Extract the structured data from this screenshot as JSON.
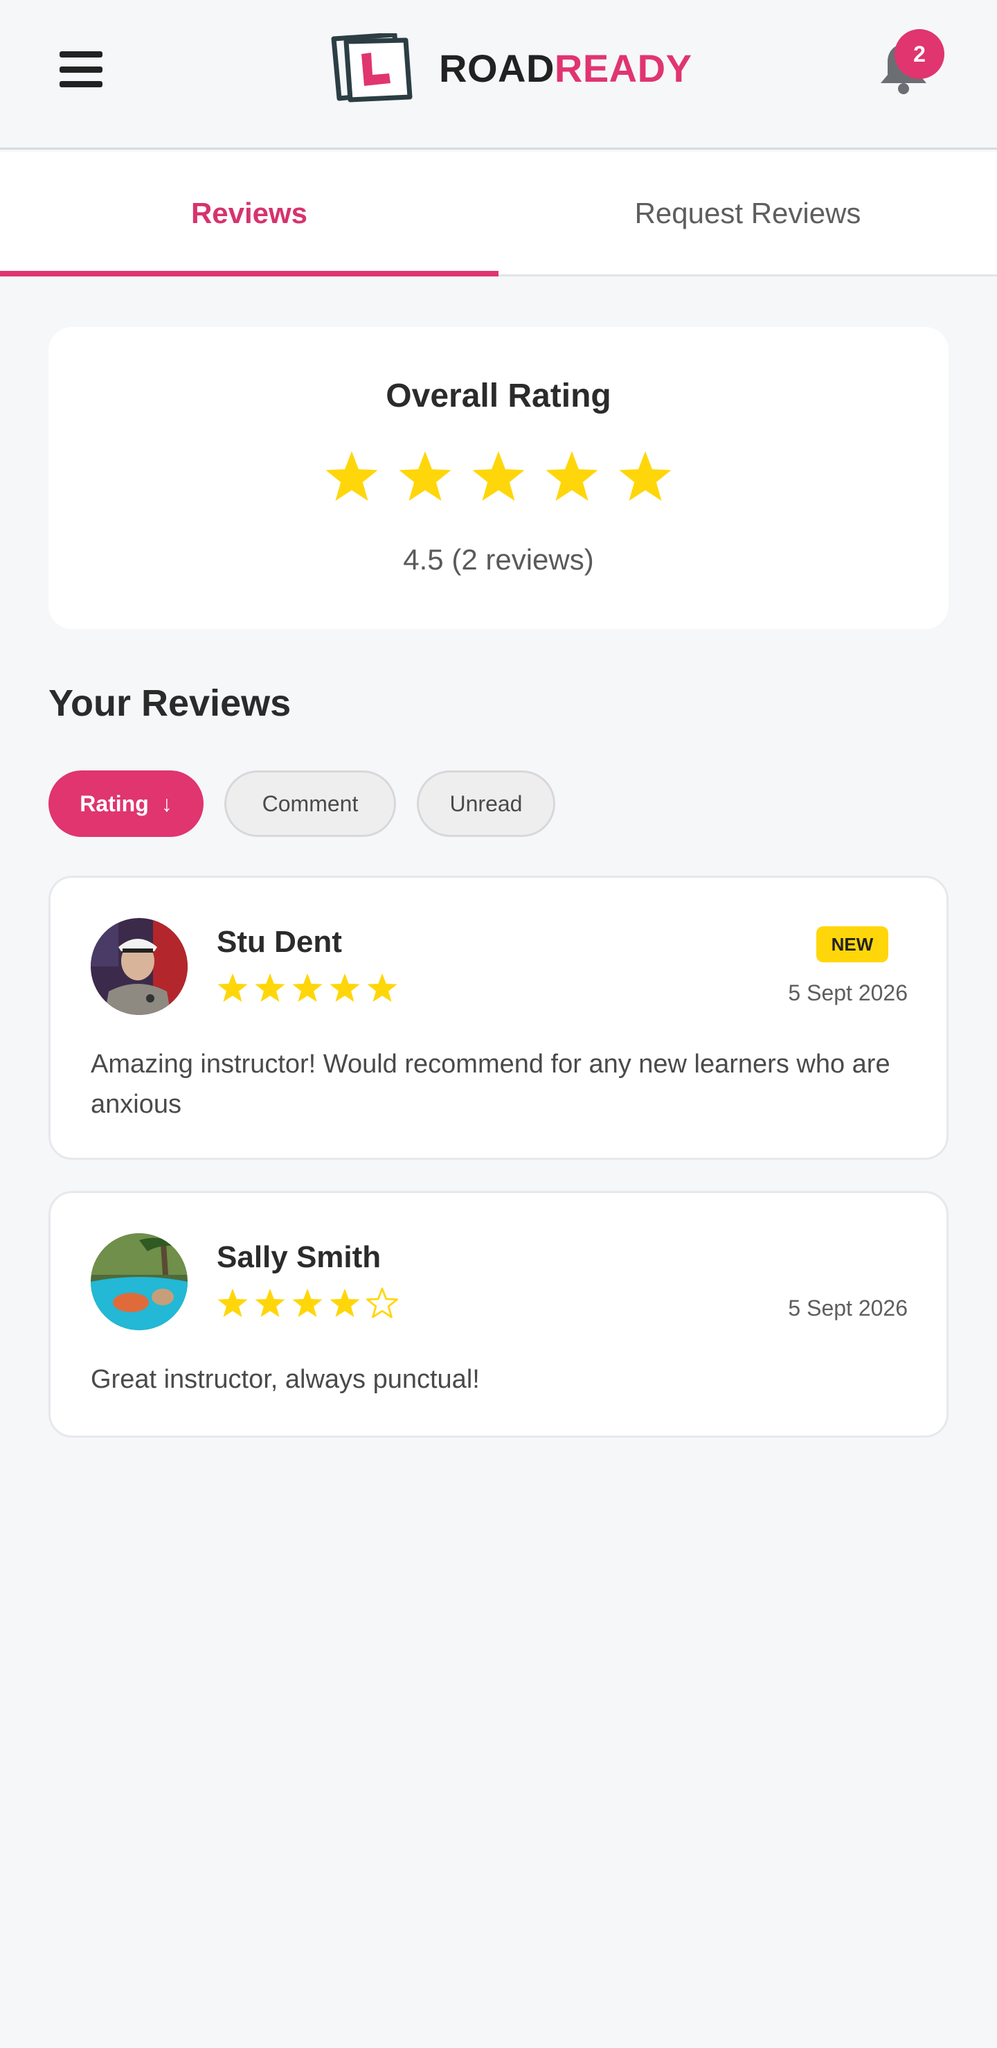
{
  "header": {
    "logo_word_1": "ROAD",
    "logo_word_2": "READY",
    "notification_count": "2",
    "menu_icon": "hamburger-icon",
    "bell_icon": "bell-icon"
  },
  "tabs": [
    {
      "label": "Reviews",
      "active": true
    },
    {
      "label": "Request Reviews",
      "active": false
    }
  ],
  "overall": {
    "title": "Overall Rating",
    "rating": 4.5,
    "stars": 5,
    "summary": "4.5 (2 reviews)"
  },
  "reviews_section": {
    "title": "Your Reviews",
    "filters": [
      {
        "label": "Rating",
        "active": true,
        "icon": "arrow-down-icon",
        "glyph": "↓"
      },
      {
        "label": "Comment",
        "active": false
      },
      {
        "label": "Unread",
        "active": false
      }
    ]
  },
  "reviews": [
    {
      "name": "Stu Dent",
      "rating": 5,
      "date": "5 Sept 2026",
      "is_new": true,
      "badge": "NEW",
      "comment": "Amazing instructor! Would recommend for any new learners who are anxious"
    },
    {
      "name": "Sally Smith",
      "rating": 4,
      "date": "5 Sept 2026",
      "is_new": false,
      "comment": "Great instructor, always punctual!"
    }
  ],
  "colors": {
    "accent": "#e0356f",
    "star": "#ffd60a",
    "background": "#f6f7f9"
  }
}
